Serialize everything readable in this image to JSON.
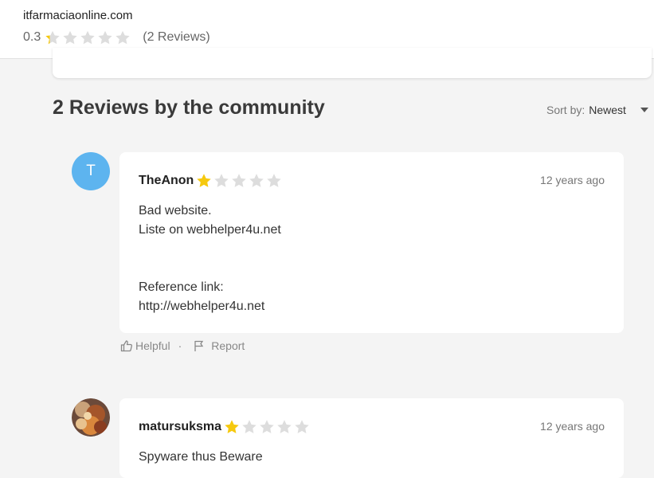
{
  "site": {
    "name": "itfarmaciaonline.com",
    "rating": "0.3",
    "rating_fill": 0.3,
    "review_count_text": "(2 Reviews)"
  },
  "section": {
    "title": "2 Reviews by the community",
    "sort_label": "Sort by:",
    "sort_value": "Newest"
  },
  "reviews": [
    {
      "avatar_letter": "T",
      "avatar_color": "#5db4ef",
      "name": "TheAnon",
      "stars": 1,
      "time": "12 years ago",
      "lines": [
        "Bad website.",
        "Liste on webhelper4u.net",
        "",
        "",
        "Reference link:",
        "http://webhelper4u.net"
      ]
    },
    {
      "avatar_image": "photo-avatar",
      "name": "matursuksma",
      "stars": 1,
      "time": "12 years ago",
      "lines": [
        "Spyware thus Beware"
      ]
    }
  ],
  "actions": {
    "helpful_label": "Helpful",
    "separator": "·",
    "report_label": "Report",
    "helpful_icon": "thumbs-up-icon",
    "report_icon": "flag-icon"
  },
  "colors": {
    "star_filled": "#f6c90e",
    "star_empty": "#dddddd",
    "background": "#f4f4f4"
  }
}
